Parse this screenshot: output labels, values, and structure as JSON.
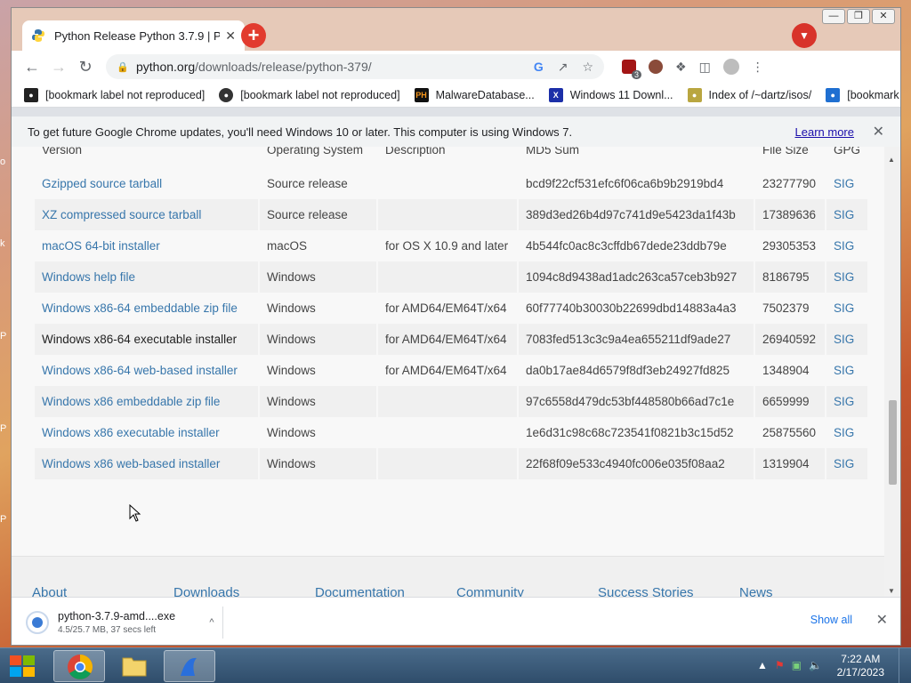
{
  "browser": {
    "tab_title": "Python Release Python 3.7.9 | P",
    "tab_close": "✕",
    "new_tab": "+",
    "url_host": "python.org",
    "url_path": "/downloads/release/python-379/",
    "extension_badge": "3",
    "window_controls": {
      "minimize": "—",
      "restore": "❐",
      "close": "✕"
    }
  },
  "bookmarks": [
    {
      "label": "[bookmark label not reproduced]",
      "icon": "shield-icon",
      "color": "#222222"
    },
    {
      "label": "[bookmark label not reproduced]",
      "icon": "globe-icon",
      "color": "#333333"
    },
    {
      "label": "MalwareDatabase...",
      "icon": "ph-logo-icon",
      "color": "#111111"
    },
    {
      "label": "Windows 11 Downl...",
      "icon": "x-logo-icon",
      "color": "#1c2fa8"
    },
    {
      "label": "Index of /~dartz/isos/",
      "icon": "figure-icon",
      "color": "#7a6a20"
    },
    {
      "label": "[bookmark label not reproduced]",
      "icon": "bubble-icon",
      "color": "#1f6fd1"
    }
  ],
  "infobar": {
    "message": "To get future Google Chrome updates, you'll need Windows 10 or later. This computer is using Windows 7.",
    "learn_more": "Learn more",
    "close": "✕"
  },
  "table": {
    "headers": [
      "Version",
      "Operating System",
      "Description",
      "MD5 Sum",
      "File Size",
      "GPG"
    ],
    "rows": [
      {
        "version": "Gzipped source tarball",
        "os": "Source release",
        "desc": "",
        "md5": "bcd9f22cf531efc6f06ca6b9b2919bd4",
        "size": "23277790",
        "gpg": "SIG",
        "visited": false
      },
      {
        "version": "XZ compressed source tarball",
        "os": "Source release",
        "desc": "",
        "md5": "389d3ed26b4d97c741d9e5423da1f43b",
        "size": "17389636",
        "gpg": "SIG",
        "visited": false
      },
      {
        "version": "macOS 64-bit installer",
        "os": "macOS",
        "desc": "for OS X 10.9 and later",
        "md5": "4b544fc0ac8c3cffdb67dede23ddb79e",
        "size": "29305353",
        "gpg": "SIG",
        "visited": false
      },
      {
        "version": "Windows help file",
        "os": "Windows",
        "desc": "",
        "md5": "1094c8d9438ad1adc263ca57ceb3b927",
        "size": "8186795",
        "gpg": "SIG",
        "visited": false
      },
      {
        "version": "Windows x86-64 embeddable zip file",
        "os": "Windows",
        "desc": "for AMD64/EM64T/x64",
        "md5": "60f77740b30030b22699dbd14883a4a3",
        "size": "7502379",
        "gpg": "SIG",
        "visited": false
      },
      {
        "version": "Windows x86-64 executable installer",
        "os": "Windows",
        "desc": "for AMD64/EM64T/x64",
        "md5": "7083fed513c3c9a4ea655211df9ade27",
        "size": "26940592",
        "gpg": "SIG",
        "visited": true
      },
      {
        "version": "Windows x86-64 web-based installer",
        "os": "Windows",
        "desc": "for AMD64/EM64T/x64",
        "md5": "da0b17ae84d6579f8df3eb24927fd825",
        "size": "1348904",
        "gpg": "SIG",
        "visited": false
      },
      {
        "version": "Windows x86 embeddable zip file",
        "os": "Windows",
        "desc": "",
        "md5": "97c6558d479dc53bf448580b66ad7c1e",
        "size": "6659999",
        "gpg": "SIG",
        "visited": false
      },
      {
        "version": "Windows x86 executable installer",
        "os": "Windows",
        "desc": "",
        "md5": "1e6d31c98c68c723541f0821b3c15d52",
        "size": "25875560",
        "gpg": "SIG",
        "visited": false
      },
      {
        "version": "Windows x86 web-based installer",
        "os": "Windows",
        "desc": "",
        "md5": "22f68f09e533c4940fc006e035f08aa2",
        "size": "1319904",
        "gpg": "SIG",
        "visited": false
      }
    ]
  },
  "footer_nav": [
    "About",
    "Downloads",
    "Documentation",
    "Community",
    "Success Stories",
    "News"
  ],
  "download": {
    "filename": "python-3.7.9-amd....exe",
    "status": "4.5/25.7 MB, 37 secs left",
    "show_all": "Show all",
    "close": "✕"
  },
  "taskbar": {
    "time": "7:22 AM",
    "date": "2/17/2023"
  },
  "colors": {
    "link": "#3776ab",
    "chrome_accent": "#1a73e8"
  }
}
